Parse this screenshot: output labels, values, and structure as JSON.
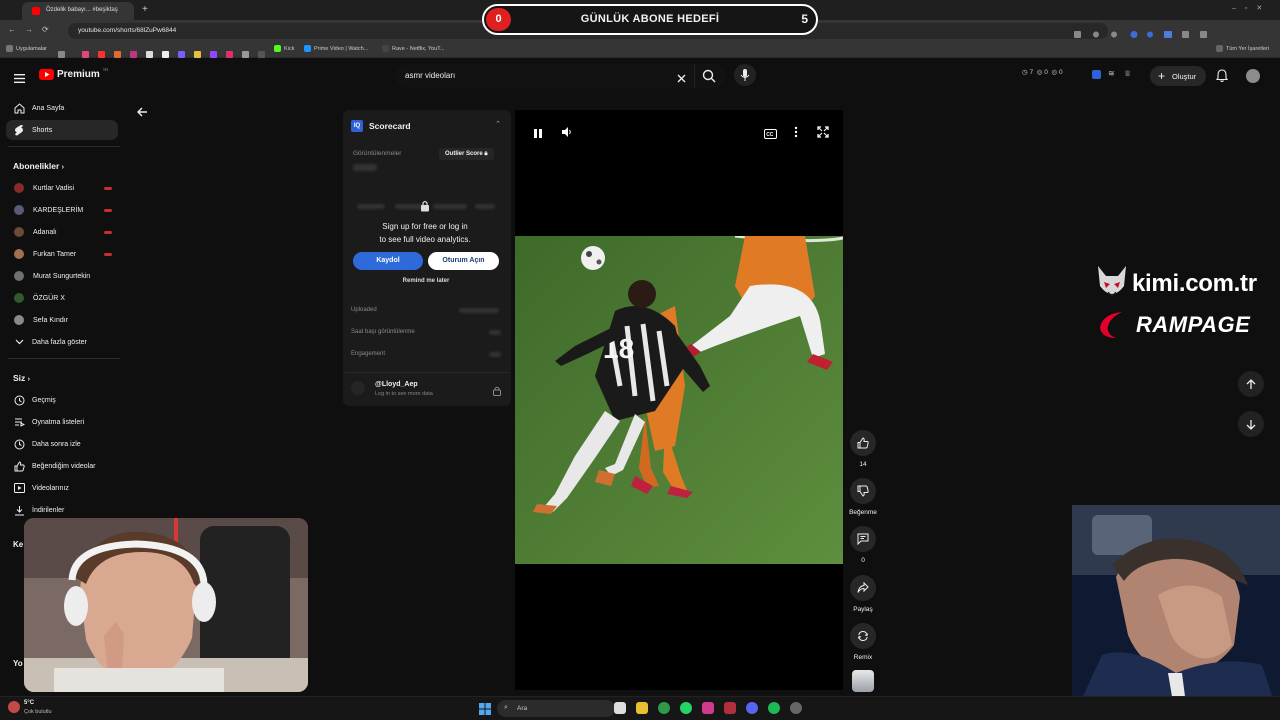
{
  "browser": {
    "tab_title": "Özdelik babayı... #beşiktaş",
    "url": "youtube.com/shorts/68lZuPw6844",
    "bookmarks": [
      "Uygulamalar",
      "Kick",
      "Prime Video | Watch...",
      "Rave - Netflix, YouT...",
      "Tüm Yer İşaretleri"
    ]
  },
  "goal_overlay": {
    "current": "0",
    "title": "GÜNLÜK ABONE HEDEFİ",
    "target": "5"
  },
  "header": {
    "logo": "Premium",
    "logo_sup": "TR",
    "search_value": "asmr videoları",
    "stats": [
      "7",
      "0",
      "0"
    ],
    "create_label": "Oluştur"
  },
  "sidebar": {
    "main": [
      {
        "label": "Ana Sayfa",
        "icon": "home-icon"
      },
      {
        "label": "Shorts",
        "icon": "shorts-icon"
      }
    ],
    "subs_heading": "Abonelikler",
    "subscriptions": [
      {
        "label": "Kurtlar Vadisi",
        "color": "#8a2b2b",
        "live": true
      },
      {
        "label": "KARDEŞLERİM",
        "color": "#5a5a7a",
        "live": true
      },
      {
        "label": "Adanalı",
        "color": "#6b4a3a",
        "live": true
      },
      {
        "label": "Furkan Tamer",
        "color": "#a07050",
        "live": true
      },
      {
        "label": "Murat Sungurtekin",
        "color": "#707070",
        "live": false
      },
      {
        "label": "ÖZGÜR X",
        "color": "#2e5a2e",
        "live": false
      },
      {
        "label": "Sefa Kındır",
        "color": "#8a8a8a",
        "live": false
      }
    ],
    "more_label": "Daha fazla göster",
    "you_heading": "Siz",
    "you_items": [
      {
        "label": "Geçmiş",
        "icon": "history-icon"
      },
      {
        "label": "Oynatma listeleri",
        "icon": "playlists-icon"
      },
      {
        "label": "Daha sonra izle",
        "icon": "watch-later-icon"
      },
      {
        "label": "Beğendiğim videolar",
        "icon": "liked-icon"
      },
      {
        "label": "Videolarınız",
        "icon": "your-videos-icon"
      },
      {
        "label": "İndirilenler",
        "icon": "downloads-icon"
      }
    ],
    "partial_labels": [
      "Ke",
      "Yo"
    ]
  },
  "scorecard": {
    "title": "Scorecard",
    "views_label": "Görüntülenmeler",
    "outlier_label": "Outlier Score",
    "lock_message_1": "Sign up for free or log in",
    "lock_message_2": "to see full video analytics.",
    "signup_label": "Kaydol",
    "login_label": "Oturum Açın",
    "remind_label": "Remind me later",
    "rows": [
      "Uploaded",
      "Saat başı görüntülenme",
      "Engagement"
    ],
    "channel": "@Lloyd_Aep",
    "channel_sub": "Log in to see more data"
  },
  "actions": {
    "likes": "14",
    "dislike_label": "Beğenme",
    "comments": "0",
    "share_label": "Paylaş",
    "remix_label": "Remix"
  },
  "video": {
    "jersey_number": "18"
  },
  "sponsor": {
    "line1": "kimi.com.tr",
    "line2": "RAMPAGE"
  },
  "taskbar": {
    "weather": "5°C",
    "weather_desc": "Çok bulutlu",
    "search_label": "Ara"
  }
}
